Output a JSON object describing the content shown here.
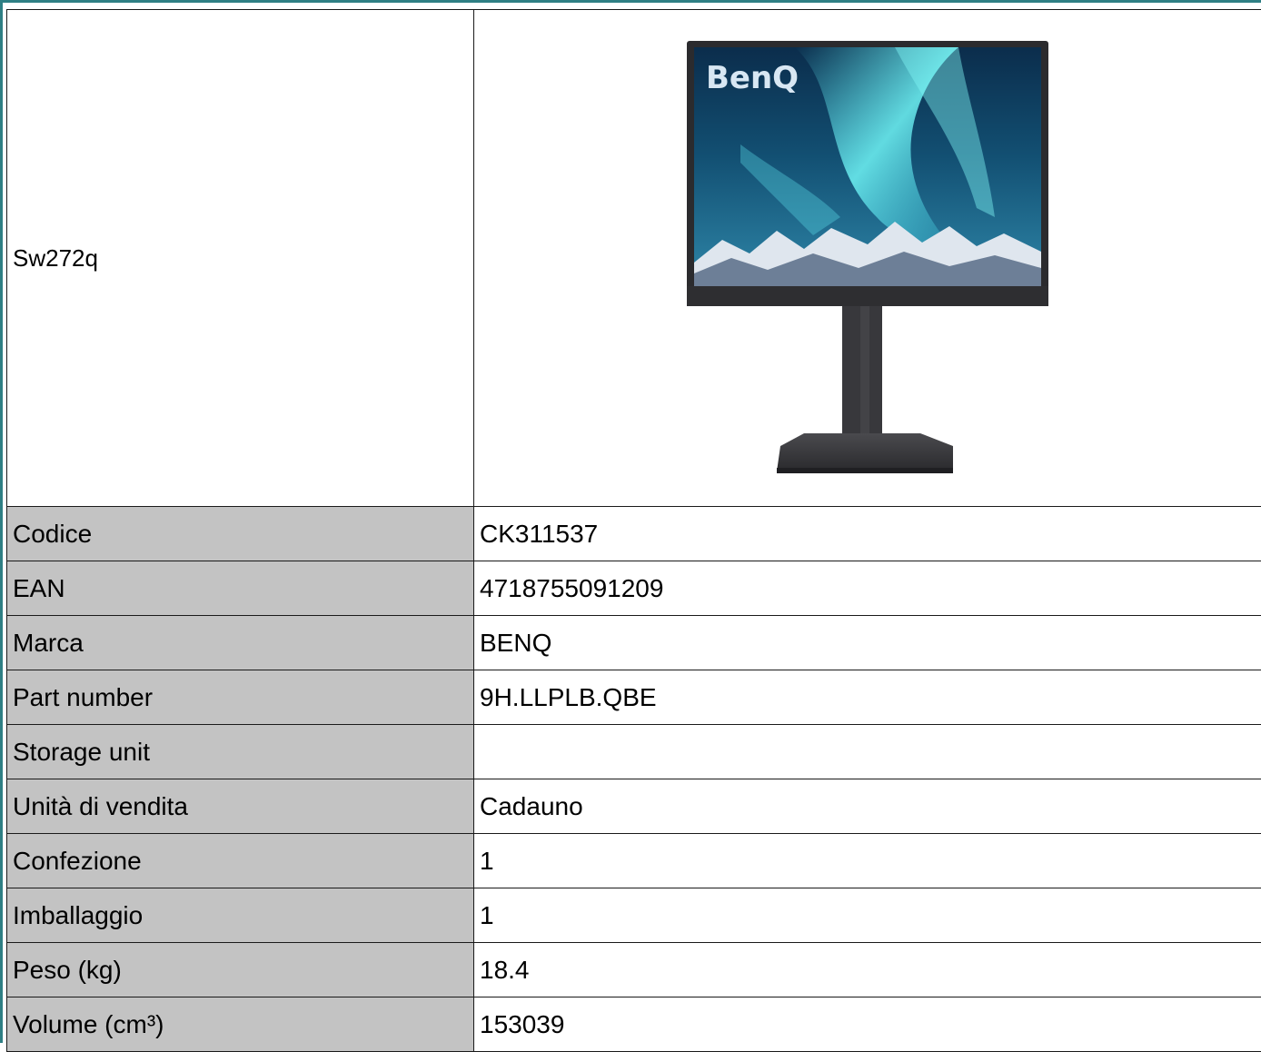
{
  "product": {
    "name": "Sw272q",
    "image": {
      "icon": "monitor-product-image-icon",
      "logo_text": "BenQ"
    }
  },
  "rows": [
    {
      "label": "Codice",
      "value": "CK311537"
    },
    {
      "label": "EAN",
      "value": "4718755091209"
    },
    {
      "label": "Marca",
      "value": "BENQ"
    },
    {
      "label": "Part number",
      "value": "9H.LLPLB.QBE"
    },
    {
      "label": "Storage unit",
      "value": ""
    },
    {
      "label": "Unità di vendita",
      "value": "Cadauno"
    },
    {
      "label": "Confezione",
      "value": "1"
    },
    {
      "label": "Imballaggio",
      "value": "1"
    },
    {
      "label": "Peso (kg)",
      "value": "18.4"
    },
    {
      "label": "Volume (cm³)",
      "value": "153039"
    }
  ],
  "colors": {
    "frame": "#2f7f84",
    "label_bg": "#c3c3c3",
    "grid": "#1a1a1a"
  }
}
